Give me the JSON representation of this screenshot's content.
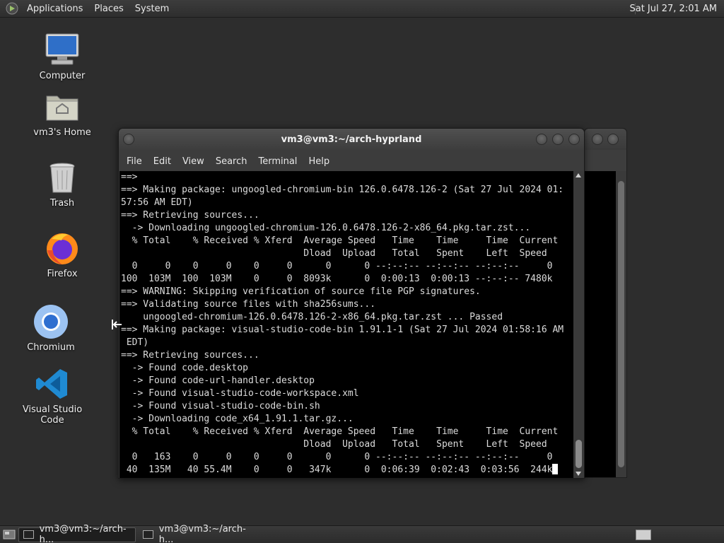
{
  "top_panel": {
    "menus": [
      "Applications",
      "Places",
      "System"
    ],
    "clock": "Sat Jul 27,  2:01 AM"
  },
  "desktop_icons": [
    {
      "label": "Computer",
      "icon": "computer-icon"
    },
    {
      "label": "vm3's Home",
      "icon": "home-folder-icon"
    },
    {
      "label": "Trash",
      "icon": "trash-icon"
    },
    {
      "label": "Firefox",
      "icon": "firefox-icon"
    },
    {
      "label": "Chromium",
      "icon": "chromium-icon"
    },
    {
      "label": "Visual Studio Code",
      "icon": "vscode-icon"
    }
  ],
  "terminal": {
    "title": "vm3@vm3:~/arch-hyprland",
    "menu": [
      "File",
      "Edit",
      "View",
      "Search",
      "Terminal",
      "Help"
    ],
    "lines": [
      "==>",
      "==> Making package: ungoogled-chromium-bin 126.0.6478.126-2 (Sat 27 Jul 2024 01:",
      "57:56 AM EDT)",
      "==> Retrieving sources...",
      "  -> Downloading ungoogled-chromium-126.0.6478.126-2-x86_64.pkg.tar.zst...",
      "  % Total    % Received % Xferd  Average Speed   Time    Time     Time  Current",
      "                                 Dload  Upload   Total   Spent    Left  Speed",
      "  0     0    0     0    0     0      0      0 --:--:-- --:--:-- --:--:--     0",
      "100  103M  100  103M    0     0  8093k      0  0:00:13  0:00:13 --:--:-- 7480k",
      "==> WARNING: Skipping verification of source file PGP signatures.",
      "==> Validating source files with sha256sums...",
      "    ungoogled-chromium-126.0.6478.126-2-x86_64.pkg.tar.zst ... Passed",
      "==> Making package: visual-studio-code-bin 1.91.1-1 (Sat 27 Jul 2024 01:58:16 AM",
      " EDT)",
      "==> Retrieving sources...",
      "  -> Found code.desktop",
      "  -> Found code-url-handler.desktop",
      "  -> Found visual-studio-code-workspace.xml",
      "  -> Found visual-studio-code-bin.sh",
      "  -> Downloading code_x64_1.91.1.tar.gz...",
      "  % Total    % Received % Xferd  Average Speed   Time    Time     Time  Current",
      "                                 Dload  Upload   Total   Spent    Left  Speed",
      "  0   163    0     0    0     0      0      0 --:--:-- --:--:-- --:--:--     0",
      " 40  135M   40 55.4M    0     0   347k      0  0:06:39  0:02:43  0:03:56  244k"
    ]
  },
  "taskbar": {
    "items": [
      "vm3@vm3:~/arch-h...",
      "vm3@vm3:~/arch-h..."
    ]
  }
}
